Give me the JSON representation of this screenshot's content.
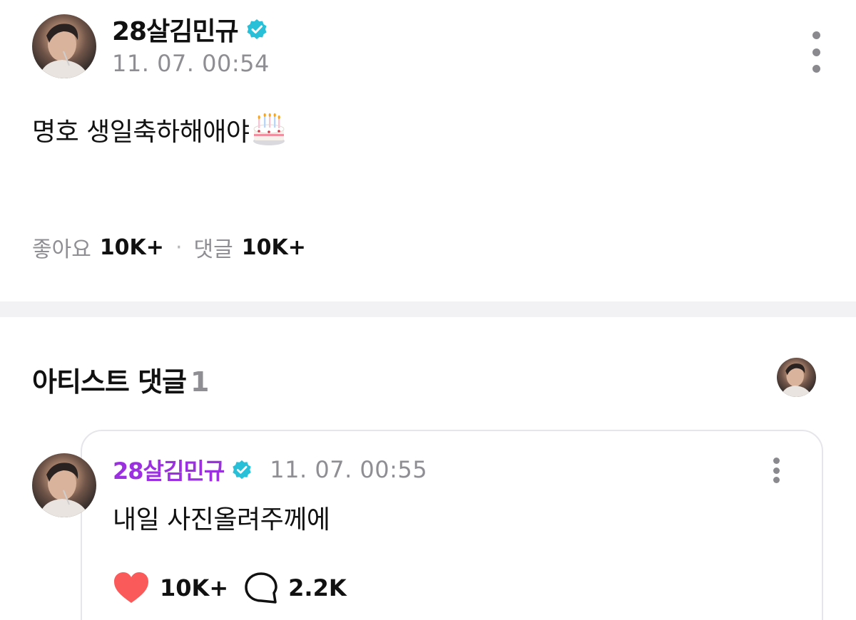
{
  "post": {
    "author": "28살김민규",
    "timestamp": "11. 07. 00:54",
    "body": "명호 생일축하해애야",
    "emoji_icon": "birthday-cake-icon",
    "likes_label": "좋아요",
    "likes_count": "10K+",
    "separator": "·",
    "comments_label": "댓글",
    "comments_count": "10K+"
  },
  "artist_comments": {
    "title": "아티스트 댓글",
    "count": "1",
    "items": [
      {
        "author": "28살김민규",
        "timestamp": "11. 07. 00:55",
        "text": "내일 사진올려주께에",
        "like_count": "10K+",
        "reply_count": "2.2K"
      }
    ]
  },
  "colors": {
    "verified_badge": "#27c0d8",
    "artist_name": "#9b30e0",
    "heart": "#fa5a5a",
    "muted_text": "#8e8e93",
    "divider": "#f2f2f4"
  }
}
